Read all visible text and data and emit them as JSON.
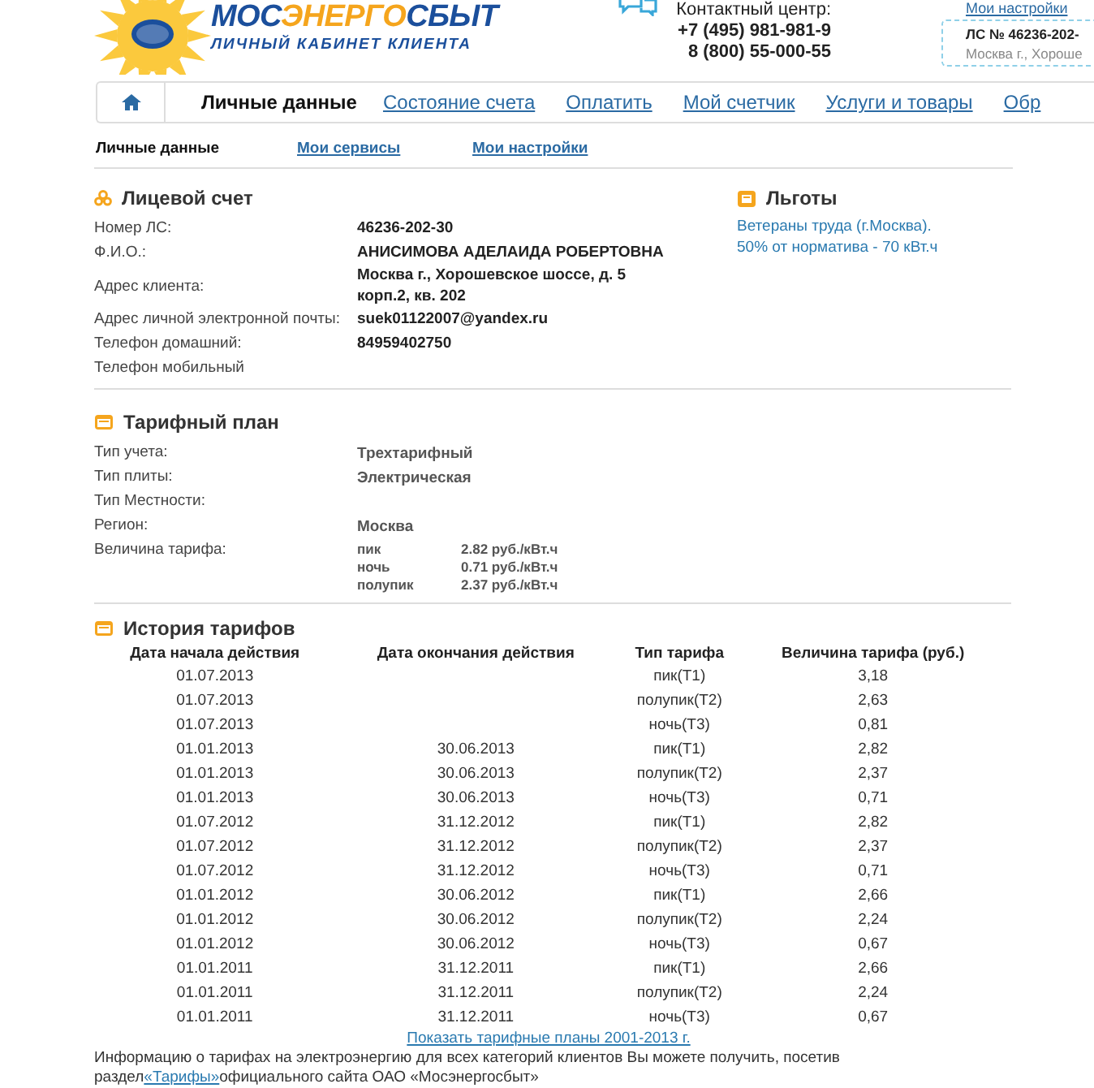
{
  "header": {
    "logo_parts": [
      {
        "text": "МОС",
        "accent": false
      },
      {
        "text": "ЭНЕРГО",
        "accent": true
      },
      {
        "text": "СБЫТ",
        "accent": false
      }
    ],
    "logo_subtitle": "ЛИЧНЫЙ КАБИНЕТ КЛИЕНТА",
    "contact_label": "Контактный центр:",
    "phones": [
      "+7 (495) 981-981-9",
      "8 (800) 55-000-55"
    ],
    "settings_link": "Мои настройки",
    "account_number": "ЛС № 46236-202-",
    "account_address": "Москва г., Хороше"
  },
  "nav": [
    {
      "label": "Личные данные",
      "selected": true
    },
    {
      "label": "Состояние счета",
      "selected": false
    },
    {
      "label": "Оплатить",
      "selected": false
    },
    {
      "label": "Мой счетчик",
      "selected": false
    },
    {
      "label": "Услуги и товары",
      "selected": false
    },
    {
      "label": "Обр",
      "selected": false
    }
  ],
  "subnav": [
    {
      "label": "Личные данные",
      "selected": true
    },
    {
      "label": "Мои сервисы",
      "selected": false
    },
    {
      "label": "Мои настройки",
      "selected": false
    }
  ],
  "account": {
    "title": "Лицевой счет",
    "rows": [
      {
        "label": "Номер ЛС:",
        "value": "46236-202-30"
      },
      {
        "label": "Ф.И.О.:",
        "value": "АНИСИМОВА АДЕЛАИДА РОБЕРТОВНА"
      },
      {
        "label": "Адрес клиента:",
        "value": "Москва г., Хорошевское шоссе, д. 5 корп.2, кв. 202"
      },
      {
        "label": "Адрес личной электронной почты:",
        "value": "suek01122007@yandex.ru"
      },
      {
        "label": "Телефон домашний:",
        "value": "84959402750"
      },
      {
        "label": "Телефон мобильный"
      }
    ]
  },
  "benefits": {
    "title": "Льготы",
    "lines": [
      "Ветераны труда (г.Москва).",
      "50% от норматива - 70 кВт.ч"
    ]
  },
  "tariff_plan": {
    "title": "Тарифный план",
    "rows": [
      {
        "label": "Тип учета:",
        "value": "Трехтарифный"
      },
      {
        "label": "Тип плиты:",
        "value": "Электрическая"
      },
      {
        "label": "Тип Местности:"
      },
      {
        "label": "Регион:",
        "value": "Москва"
      },
      {
        "label": "Величина тарифа:",
        "rates": [
          {
            "zone": "пик",
            "price": "2.82 руб./кВт.ч"
          },
          {
            "zone": "ночь",
            "price": "0.71 руб./кВт.ч"
          },
          {
            "zone": "полупик",
            "price": "2.37 руб./кВт.ч"
          }
        ]
      }
    ]
  },
  "history": {
    "title": "История тарифов",
    "columns": [
      "Дата начала действия",
      "Дата окончания действия",
      "Тип тарифа",
      "Величина тарифа (руб.)"
    ],
    "rows": [
      [
        "01.07.2013",
        "",
        "пик(Т1)",
        "3,18"
      ],
      [
        "01.07.2013",
        "",
        "полупик(Т2)",
        "2,63"
      ],
      [
        "01.07.2013",
        "",
        "ночь(Т3)",
        "0,81"
      ],
      [
        "01.01.2013",
        "30.06.2013",
        "пик(Т1)",
        "2,82"
      ],
      [
        "01.01.2013",
        "30.06.2013",
        "полупик(Т2)",
        "2,37"
      ],
      [
        "01.01.2013",
        "30.06.2013",
        "ночь(Т3)",
        "0,71"
      ],
      [
        "01.07.2012",
        "31.12.2012",
        "пик(Т1)",
        "2,82"
      ],
      [
        "01.07.2012",
        "31.12.2012",
        "полупик(Т2)",
        "2,37"
      ],
      [
        "01.07.2012",
        "31.12.2012",
        "ночь(Т3)",
        "0,71"
      ],
      [
        "01.01.2012",
        "30.06.2012",
        "пик(Т1)",
        "2,66"
      ],
      [
        "01.01.2012",
        "30.06.2012",
        "полупик(Т2)",
        "2,24"
      ],
      [
        "01.01.2012",
        "30.06.2012",
        "ночь(Т3)",
        "0,67"
      ],
      [
        "01.01.2011",
        "31.12.2011",
        "пик(Т1)",
        "2,66"
      ],
      [
        "01.01.2011",
        "31.12.2011",
        "полупик(Т2)",
        "2,24"
      ],
      [
        "01.01.2011",
        "31.12.2011",
        "ночь(Т3)",
        "0,67"
      ]
    ],
    "show_link": "Показать тарифные планы 2001-2013 г.",
    "info_before": "Информацию о тарифах на электроэнергию для всех категорий клиентов Вы можете получить, посетив раздел",
    "info_link": "«Тарифы»",
    "info_after": "официального сайта ОАО «Мосэнергосбыт»"
  }
}
